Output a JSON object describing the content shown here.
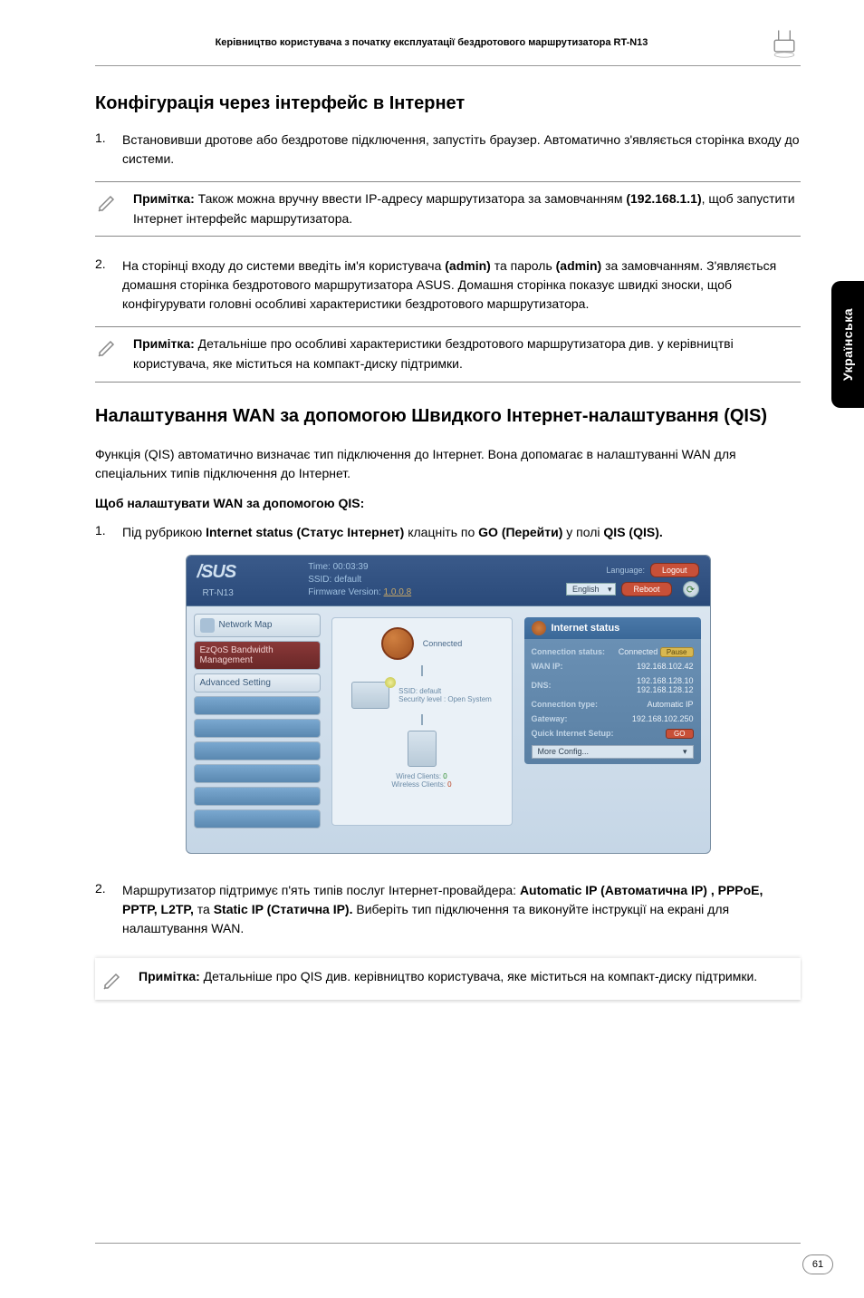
{
  "header": {
    "title": "Керівництво користувача з початку експлуатації бездротового маршрутизатора RT-N13"
  },
  "side_tab": "Українська",
  "section1": {
    "title": "Конфігурація через інтерфейс в Інтернет",
    "step1_num": "1.",
    "step1_text": "Встановивши дротове або бездротове підключення, запустіть браузер. Автоматично з'являється сторінка входу до системи.",
    "note1": {
      "prefix": "Примітка:",
      "text": " Також можна вручну ввести ІР-адресу маршрутизатора за замовчанням ",
      "ip": "(192.168.1.1)",
      "suffix": ", щоб запустити Інтернет інтерфейс маршрутизатора."
    },
    "step2_num": "2.",
    "step2_text_a": "На сторінці входу до системи введіть ім'я користувача ",
    "step2_admin1": "(admin)",
    "step2_text_b": " та пароль ",
    "step2_admin2": "(admin)",
    "step2_text_c": " за замовчанням. З'являється домашня сторінка бездротового маршрутизатора ASUS. Домашня сторінка показує швидкі зноски, щоб конфігурувати головні особливі характеристики бездротового маршрутизатора.",
    "note2": {
      "prefix": "Примітка:",
      "text": " Детальніше про особливі характеристики бездротового маршрутизатора див. у керівництві користувача, яке міститься на компакт-диску підтримки."
    }
  },
  "section2": {
    "title": "Налаштування WAN за допомогою Швидкого Інтернет-налаштування (QIS)",
    "intro": "Функція (QIS) автоматично визначає тип підключення до Інтернет. Вона допомагає в налаштуванні WAN для спеціальних типів підключення до Інтернет.",
    "sub": "Щоб налаштувати WAN за допомогою QIS:",
    "step1_num": "1.",
    "step1_a": "Під рубрикою ",
    "step1_b": "Internet status (Статус Інтернет)",
    "step1_c": " клацніть по ",
    "step1_d": "GO (Перейти)",
    "step1_e": " у полі ",
    "step1_f": "QIS (QIS).",
    "step2_num": "2.",
    "step2_a": "Маршрутизатор підтримує п'ять типів послуг Інтернет-провайдера: ",
    "step2_b": "Automatic IP (Автоматична ІР) , PPPoE, PPTP, L2TP,",
    "step2_c": " та ",
    "step2_d": "Static IP (Статична IP).",
    "step2_e": " Виберіть тип підключення та виконуйте інструкції на екрані для налаштування WAN.",
    "note3": {
      "prefix": "Примітка:",
      "text": " Детальніше про QIS див. керівництво користувача, яке міститься на компакт-диску підтримки."
    }
  },
  "screenshot": {
    "logo": "/SUS",
    "model": "RT-N13",
    "time_label": "Time: 00:03:39",
    "ssid_label": "SSID: default",
    "fw_label": "Firmware Version: ",
    "fw_link": "1.0.0.8",
    "lang_label": "Language:",
    "lang_value": "English",
    "btn_logout": "Logout",
    "btn_reboot": "Reboot",
    "nav_map": "Network Map",
    "nav_ezqos": "EzQoS Bandwidth Management",
    "nav_adv": "Advanced Setting",
    "center_connected": "Connected",
    "center_ssid": "SSID: default",
    "center_sec": "Security level : Open System",
    "center_wired": "Wired Clients: ",
    "center_wireless": "Wireless Clients: ",
    "wired_n": "0",
    "wireless_n": "0",
    "istatus_hdr": "Internet status",
    "r_conn_k": "Connection status:",
    "r_conn_v": "Connected",
    "r_pause": "Pause",
    "r_wan_k": "WAN IP:",
    "r_wan_v": "192.168.102.42",
    "r_dns_k": "DNS:",
    "r_dns_v1": "192.168.128.10",
    "r_dns_v2": "192.168.128.12",
    "r_ct_k": "Connection type:",
    "r_ct_v": "Automatic IP",
    "r_gw_k": "Gateway:",
    "r_gw_v": "192.168.102.250",
    "r_qis_k": "Quick Internet Setup:",
    "r_go": "GO",
    "r_more": "More Config..."
  },
  "page_number": "61"
}
